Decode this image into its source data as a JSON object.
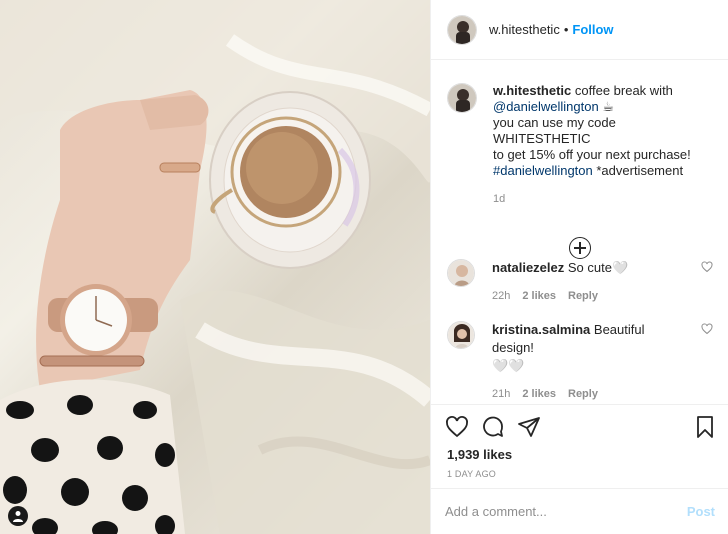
{
  "post": {
    "username": "w.hitesthetic",
    "dot": "•",
    "follow_label": "Follow"
  },
  "caption": {
    "username": "w.hitesthetic",
    "text_before_mention": " coffee break with",
    "mention": "@danielwellington",
    "line2_emoji": " ☕",
    "line3": "you can use my code WHITESTHETIC",
    "line4": "to get 15% off your next purchase!",
    "hashtag": "#danielwellington",
    "text_after_hashtag": " *advertisement",
    "time": "1d"
  },
  "comments": [
    {
      "username": "nataliezelez",
      "text": " So cute🤍",
      "time": "22h",
      "likes": "2 likes",
      "reply": "Reply"
    },
    {
      "username": "kristina.salmina",
      "text": " Beautiful design!",
      "text2": "🤍🤍",
      "time": "21h",
      "likes": "2 likes",
      "reply": "Reply"
    }
  ],
  "likes_count": "1,939 likes",
  "posted_ago": "1 DAY AGO",
  "add_comment": {
    "placeholder": "Add a comment...",
    "post_label": "Post"
  },
  "icons": [
    "heart-icon",
    "comment-icon",
    "share-icon",
    "bookmark-icon",
    "load-more-icon",
    "user-tag-icon"
  ],
  "colors": {
    "accent": "#0095f6",
    "link": "#00376b",
    "muted": "#8e8e8e",
    "post_disabled": "#b2dffc"
  }
}
